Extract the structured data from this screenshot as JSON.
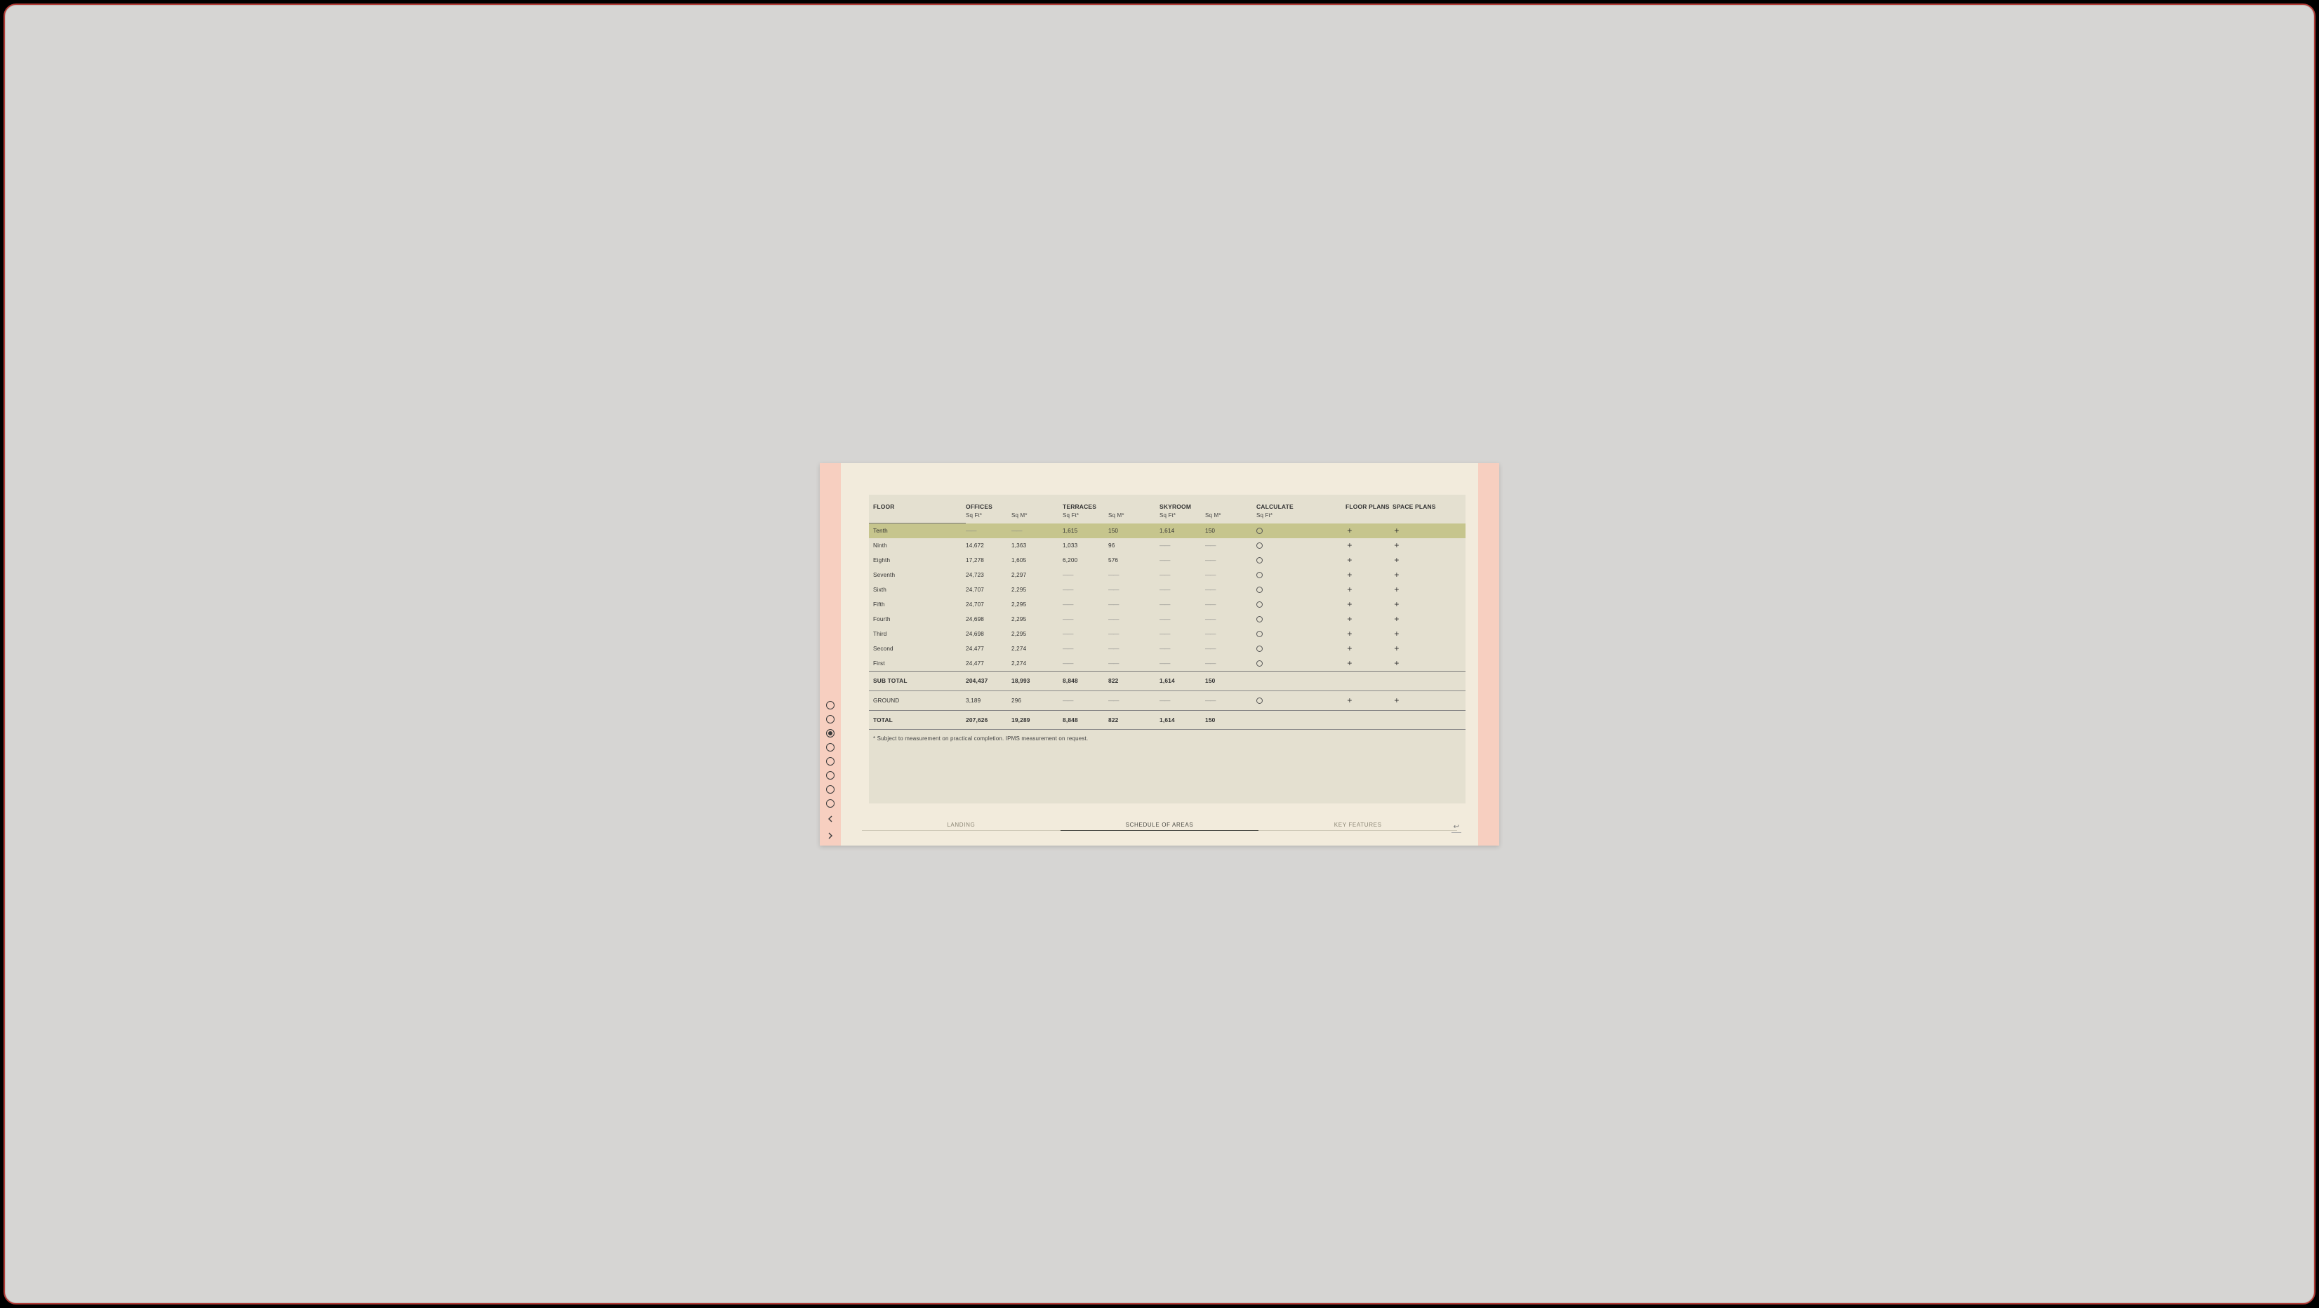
{
  "nav": {
    "dot_count": 8,
    "active_dot_index": 2
  },
  "headers": {
    "floor": "FLOOR",
    "offices": "OFFICES",
    "terraces": "TERRACES",
    "skyroom": "SKYROOM",
    "calculate": "CALCULATE",
    "floor_plans": "FLOOR PLANS",
    "space_plans": "SPACE PLANS",
    "sqft": "Sq Ft*",
    "sqm": "Sq M*"
  },
  "rows": [
    {
      "floor": "Tenth",
      "off_ft": "—",
      "off_m": "—",
      "ter_ft": "1,615",
      "ter_m": "150",
      "sky_ft": "1,614",
      "sky_m": "150",
      "calc": true,
      "fp": true,
      "sp": true,
      "highlight": true
    },
    {
      "floor": "Ninth",
      "off_ft": "14,672",
      "off_m": "1,363",
      "ter_ft": "1,033",
      "ter_m": "96",
      "sky_ft": "—",
      "sky_m": "—",
      "calc": true,
      "fp": true,
      "sp": true
    },
    {
      "floor": "Eighth",
      "off_ft": "17,278",
      "off_m": "1,605",
      "ter_ft": "6,200",
      "ter_m": "576",
      "sky_ft": "—",
      "sky_m": "—",
      "calc": true,
      "fp": true,
      "sp": true
    },
    {
      "floor": "Seventh",
      "off_ft": "24,723",
      "off_m": "2,297",
      "ter_ft": "—",
      "ter_m": "—",
      "sky_ft": "—",
      "sky_m": "—",
      "calc": true,
      "fp": true,
      "sp": true
    },
    {
      "floor": "Sixth",
      "off_ft": "24,707",
      "off_m": "2,295",
      "ter_ft": "—",
      "ter_m": "—",
      "sky_ft": "—",
      "sky_m": "—",
      "calc": true,
      "fp": true,
      "sp": true
    },
    {
      "floor": "Fifth",
      "off_ft": "24,707",
      "off_m": "2,295",
      "ter_ft": "—",
      "ter_m": "—",
      "sky_ft": "—",
      "sky_m": "—",
      "calc": true,
      "fp": true,
      "sp": true
    },
    {
      "floor": "Fourth",
      "off_ft": "24,698",
      "off_m": "2,295",
      "ter_ft": "—",
      "ter_m": "—",
      "sky_ft": "—",
      "sky_m": "—",
      "calc": true,
      "fp": true,
      "sp": true
    },
    {
      "floor": "Third",
      "off_ft": "24,698",
      "off_m": "2,295",
      "ter_ft": "—",
      "ter_m": "—",
      "sky_ft": "—",
      "sky_m": "—",
      "calc": true,
      "fp": true,
      "sp": true
    },
    {
      "floor": "Second",
      "off_ft": "24,477",
      "off_m": "2,274",
      "ter_ft": "—",
      "ter_m": "—",
      "sky_ft": "—",
      "sky_m": "—",
      "calc": true,
      "fp": true,
      "sp": true
    },
    {
      "floor": "First",
      "off_ft": "24,477",
      "off_m": "2,274",
      "ter_ft": "—",
      "ter_m": "—",
      "sky_ft": "—",
      "sky_m": "—",
      "calc": true,
      "fp": true,
      "sp": true
    }
  ],
  "subtotal": {
    "label": "SUB TOTAL",
    "off_ft": "204,437",
    "off_m": "18,993",
    "ter_ft": "8,848",
    "ter_m": "822",
    "sky_ft": "1,614",
    "sky_m": "150"
  },
  "ground": {
    "label": "GROUND",
    "off_ft": "3,189",
    "off_m": "296",
    "ter_ft": "—",
    "ter_m": "—",
    "sky_ft": "—",
    "sky_m": "—",
    "calc": true,
    "fp": true,
    "sp": true
  },
  "total": {
    "label": "TOTAL",
    "off_ft": "207,626",
    "off_m": "19,289",
    "ter_ft": "8,848",
    "ter_m": "822",
    "sky_ft": "1,614",
    "sky_m": "150"
  },
  "footnote": "* Subject to measurement on practical completion. IPMS measurement on request.",
  "pager": {
    "prev": "LANDING",
    "current": "SCHEDULE OF AREAS",
    "next": "KEY FEATURES",
    "share_icon": "↩"
  }
}
